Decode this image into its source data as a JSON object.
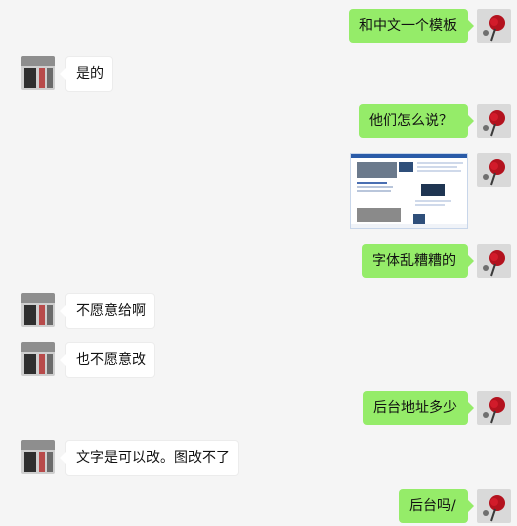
{
  "messages": [
    {
      "side": "right",
      "type": "text",
      "text": "和中文一个模板"
    },
    {
      "side": "left",
      "type": "text",
      "text": "是的"
    },
    {
      "side": "right",
      "type": "text",
      "text": "他们怎么说？"
    },
    {
      "side": "right",
      "type": "image",
      "icon": "webpage-screenshot-thumbnail"
    },
    {
      "side": "right",
      "type": "text",
      "text": "字体乱糟糟的"
    },
    {
      "side": "left",
      "type": "text",
      "text": "不愿意给啊"
    },
    {
      "side": "left",
      "type": "text",
      "text": "也不愿意改"
    },
    {
      "side": "right",
      "type": "text",
      "text": "后台地址多少"
    },
    {
      "side": "left",
      "type": "text",
      "text": "文字是可以改。图改不了"
    },
    {
      "side": "right",
      "type": "text",
      "text": "后台吗/"
    }
  ],
  "avatars": {
    "self_icon": "red-rose-avatar",
    "contact_icon": "storefront-photo-avatar"
  },
  "colors": {
    "background": "#f5f5f5",
    "self_bubble": "#95ec69",
    "contact_bubble": "#ffffff"
  }
}
